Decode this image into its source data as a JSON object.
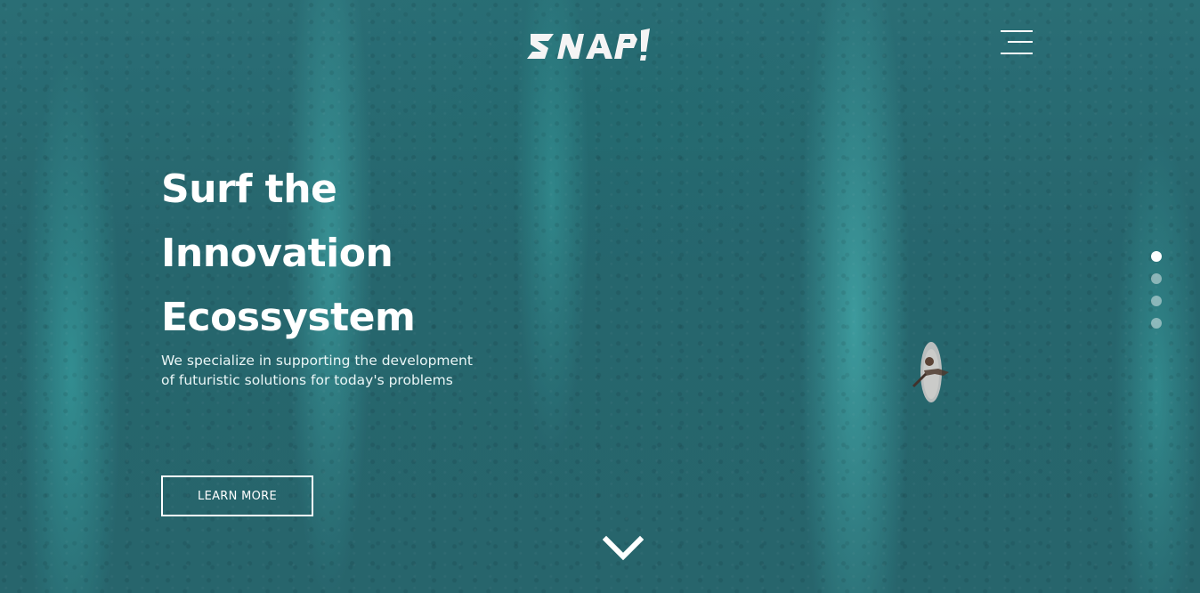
{
  "header": {
    "logo_text": "SNAP!",
    "menu_icon": "hamburger-icon"
  },
  "hero": {
    "headline_lines": [
      "Surf the",
      "Innovation",
      "Ecossystem"
    ],
    "subtitle_lines": [
      "We specialize in supporting the development",
      "of futuristic solutions for today's problems"
    ],
    "cta_label": "LEARN MORE",
    "scroll_icon": "chevron-down-icon"
  },
  "slider": {
    "total_slides": 4,
    "active_index": 0
  },
  "colors": {
    "text": "#ffffff",
    "water": "#2b7377",
    "accent_water": "#55d7d2"
  }
}
